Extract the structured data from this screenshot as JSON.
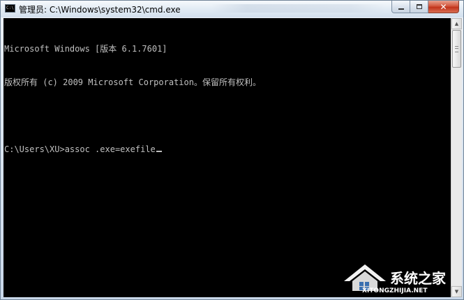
{
  "window": {
    "title": "管理员: C:\\Windows\\system32\\cmd.exe",
    "icon": "cmd-icon",
    "icon_glyph": "C:\\"
  },
  "caption_buttons": {
    "minimize_icon": "minimize-icon",
    "maximize_icon": "maximize-icon",
    "close_icon": "close-icon",
    "close_glyph": "✕"
  },
  "console": {
    "background": "#000000",
    "foreground": "#c0c0c0",
    "lines": [
      "Microsoft Windows [版本 6.1.7601]",
      "版权所有 (c) 2009 Microsoft Corporation。保留所有权利。",
      "",
      "C:\\Users\\XU>assoc .exe=exefile"
    ]
  },
  "scrollbar": {
    "up_glyph": "▲",
    "down_glyph": "▼"
  },
  "watermark": {
    "brand": "系统之家",
    "url": "XITONGZHIJIA.NET"
  }
}
